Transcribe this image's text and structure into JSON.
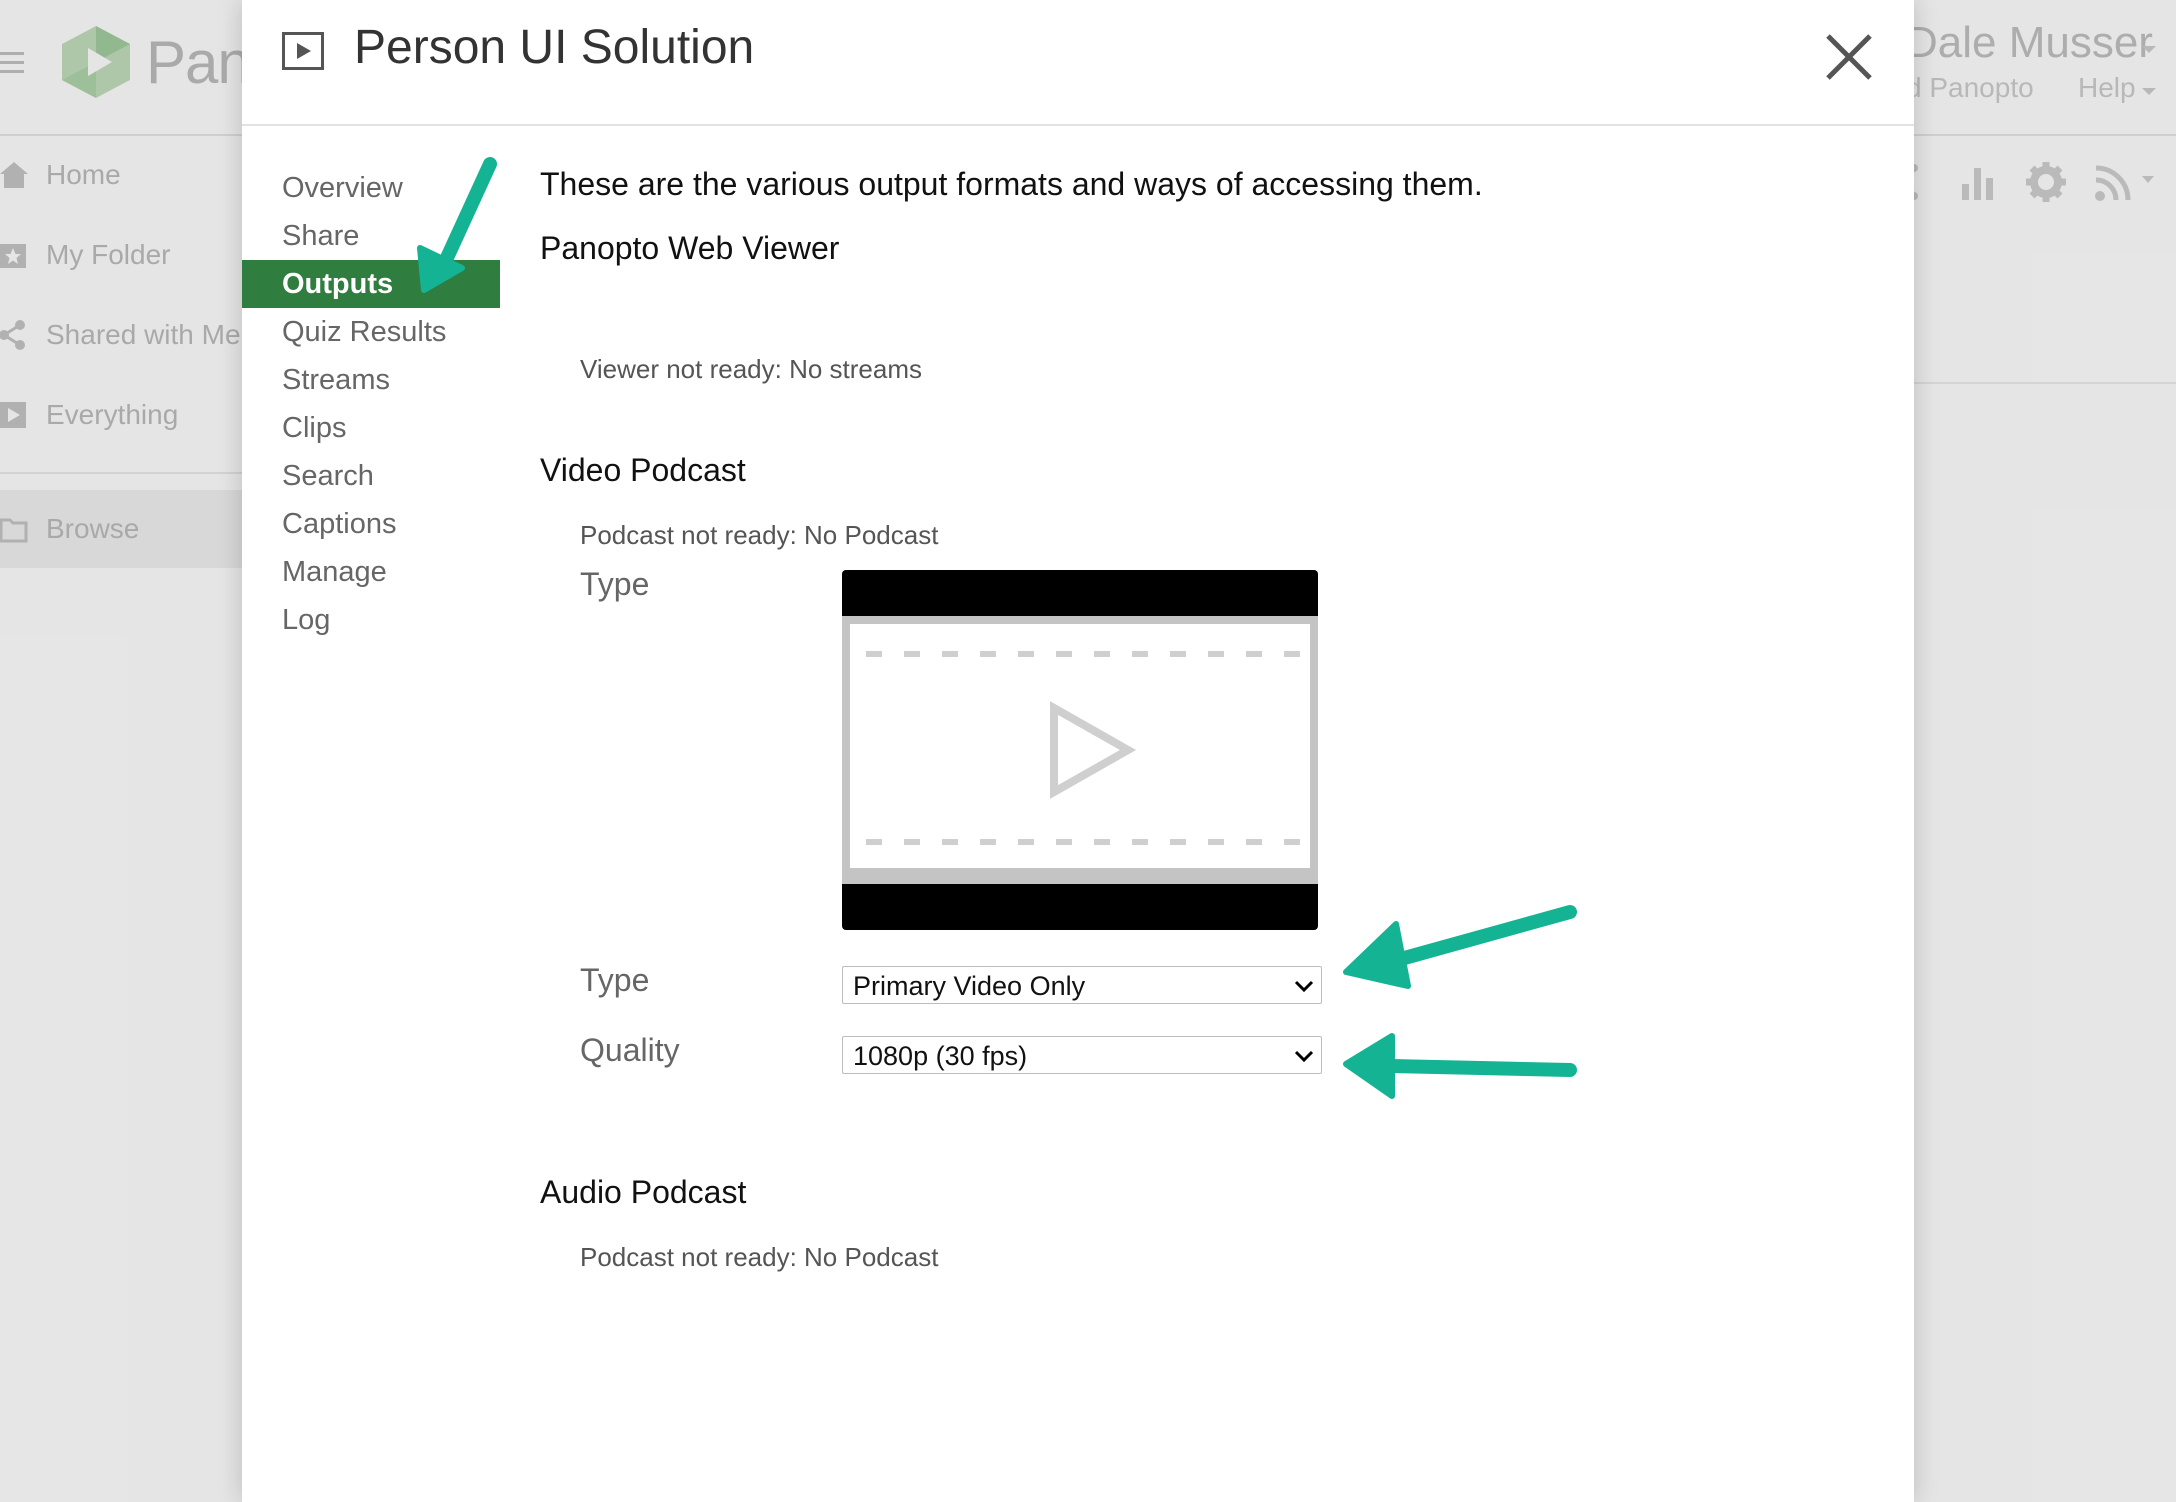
{
  "background": {
    "logo_text": "Pan",
    "user_name": "Dale Musser",
    "user_sub": "d Panopto",
    "help_label": "Help",
    "nav": [
      {
        "label": "Home",
        "icon": "home-icon"
      },
      {
        "label": "My Folder",
        "icon": "star-folder-icon"
      },
      {
        "label": "Shared with Me",
        "icon": "share-icon"
      },
      {
        "label": "Everything",
        "icon": "video-icon"
      },
      {
        "label": "Browse",
        "icon": "folder-icon"
      }
    ],
    "toolbar_icons": [
      "share-icon",
      "stats-icon",
      "gear-icon",
      "rss-icon"
    ]
  },
  "modal": {
    "title": "Person UI Solution",
    "tabs": [
      {
        "label": "Overview",
        "active": false
      },
      {
        "label": "Share",
        "active": false
      },
      {
        "label": "Outputs",
        "active": true
      },
      {
        "label": "Quiz Results",
        "active": false
      },
      {
        "label": "Streams",
        "active": false
      },
      {
        "label": "Clips",
        "active": false
      },
      {
        "label": "Search",
        "active": false
      },
      {
        "label": "Captions",
        "active": false
      },
      {
        "label": "Manage",
        "active": false
      },
      {
        "label": "Log",
        "active": false
      }
    ],
    "intro": "These are the various output formats and ways of accessing them.",
    "web_viewer": {
      "heading": "Panopto Web Viewer",
      "status": "Viewer not ready: No streams"
    },
    "video_podcast": {
      "heading": "Video Podcast",
      "status": "Podcast not ready: No Podcast",
      "type_label": "Type",
      "type2_label": "Type",
      "type_value": "Primary Video Only",
      "quality_label": "Quality",
      "quality_value": "1080p (30 fps)"
    },
    "audio_podcast": {
      "heading": "Audio Podcast",
      "status": "Podcast not ready: No Podcast"
    }
  },
  "colors": {
    "active_tab": "#2f7d3f",
    "annotation_arrow": "#14b394"
  }
}
